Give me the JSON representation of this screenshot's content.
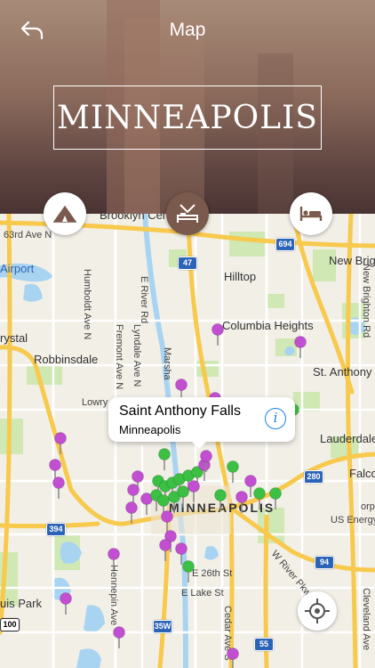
{
  "header": {
    "title": "Map",
    "city": "MINNEAPOLIS",
    "back_icon": "back-arrow-icon"
  },
  "categories": [
    {
      "name": "camping",
      "icon": "tent-icon",
      "active": false
    },
    {
      "name": "hotels",
      "icon": "bed-icon",
      "active": true
    },
    {
      "name": "lodging",
      "icon": "bed-icon",
      "active": false
    }
  ],
  "colors": {
    "accent": "#7a5a4c",
    "pin_purple": "#c24fd1",
    "pin_green": "#3cc043",
    "water": "#a8d4f2",
    "highway": "#f7c94c"
  },
  "map": {
    "labels": {
      "brooklyn": "Brooklyn Cen",
      "ave63": "63rd Ave N",
      "airport": "Airport",
      "hilltop": "Hilltop",
      "new_brig": "New Brig",
      "columbia": "Columbia Heights",
      "crystal": "rystal",
      "robbinsdale": "Robbinsdale",
      "st_anthony": "St. Anthony",
      "lowry": "Lowry Ave",
      "lauderdale": "Lauderdale",
      "falco": "Falco",
      "minneapolis": "MINNEAPOLIS",
      "us_energy": "US Energy Pa",
      "corp": "orp",
      "lakes_park": "uis Park",
      "e_26th": "E 26th St",
      "e_lake": "E Lake St",
      "e_river": "E River Rd",
      "humboldt": "Humboldt Ave N",
      "fremont": "Fremont Ave N",
      "lyndale": "Lyndale Ave N",
      "marsh": "Marsha",
      "hennepin": "Hennepin Ave",
      "cedar": "Cedar Ave S",
      "w_river": "W River Pkwy",
      "new_brighton": "New Brighton Rd",
      "cleveland": "Cleveland Ave"
    },
    "shields": {
      "i694": "694",
      "i47": "47",
      "i280": "280",
      "i394": "394",
      "i94": "94",
      "i35w": "35W",
      "i55": "55",
      "i100": "100"
    }
  },
  "callout": {
    "title": "Saint Anthony Falls",
    "subtitle": "Minneapolis"
  }
}
